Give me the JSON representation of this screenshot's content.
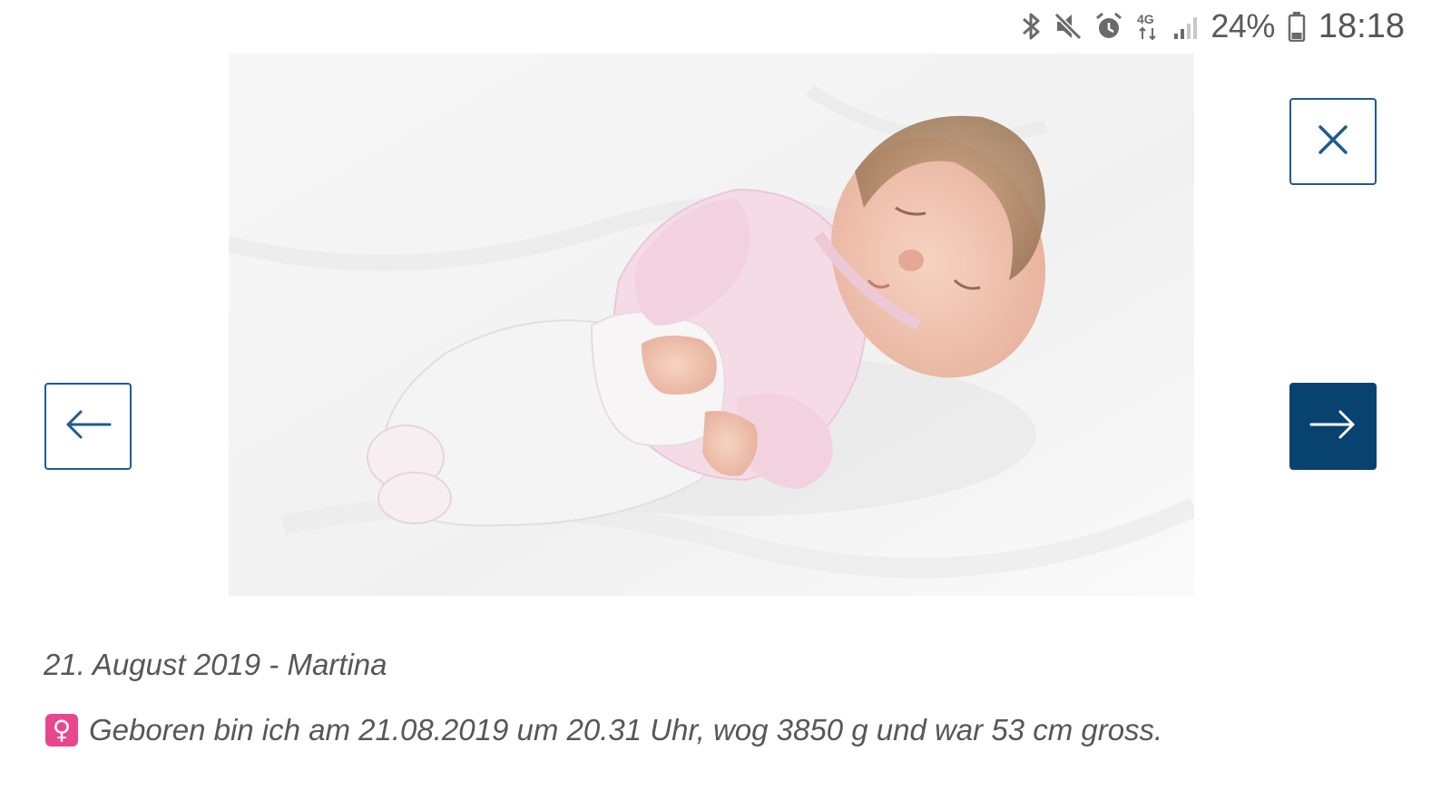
{
  "status_bar": {
    "battery": "24%",
    "time": "18:18",
    "network": "4G",
    "icons": [
      "bluetooth-icon",
      "mute-icon",
      "alarm-icon",
      "network-4g-icon",
      "signal-icon",
      "battery-icon"
    ]
  },
  "gallery": {
    "photo_icon": "baby-photo",
    "close_icon": "close-icon",
    "prev_icon": "arrow-left-icon",
    "next_icon": "arrow-right-icon",
    "accent_color": "#08426f"
  },
  "caption": "21. August 2019 - Martina",
  "description": {
    "badge_glyph": "♀",
    "text": "Geboren bin ich am 21.08.2019 um 20.31 Uhr, wog 3850 g und war 53 cm gross."
  }
}
